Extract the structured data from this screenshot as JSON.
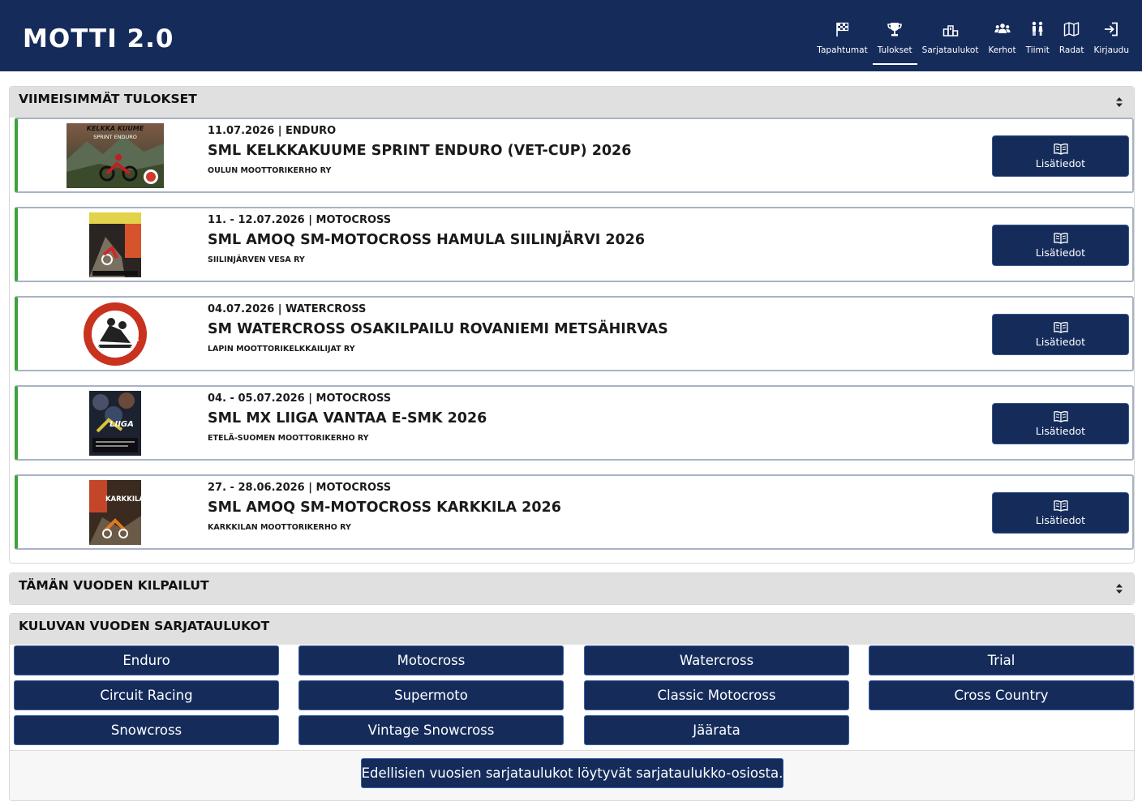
{
  "header": {
    "logo": "MOTTI 2.0",
    "nav": [
      {
        "label": "Tapahtumat",
        "icon": "checkered-flag-icon"
      },
      {
        "label": "Tulokset",
        "icon": "trophy-icon",
        "active": true
      },
      {
        "label": "Sarjataulukot",
        "icon": "podium-icon"
      },
      {
        "label": "Kerhot",
        "icon": "people-group-icon"
      },
      {
        "label": "Tiimit",
        "icon": "team-people-icon"
      },
      {
        "label": "Radat",
        "icon": "map-icon"
      },
      {
        "label": "Kirjaudu",
        "icon": "login-icon"
      }
    ]
  },
  "latest_results": {
    "title": "VIIMEISIMMÄT TULOKSET",
    "items": [
      {
        "date": "11.07.2026 | ENDURO",
        "title": "SML KELKKAKUUME SPRINT ENDURO (VET-CUP) 2026",
        "organizer": "OULUN MOOTTORIKERHO RY",
        "button": "Lisätiedot",
        "poster_text": "KELKKA KUUME",
        "poster_sub": "SPRINT ENDURO"
      },
      {
        "date": "11. - 12.07.2026 | MOTOCROSS",
        "title": "SML AMOQ SM-MOTOCROSS HAMULA SIILINJÄRVI 2026",
        "organizer": "SIILINJÄRVEN VESA RY",
        "button": "Lisätiedot"
      },
      {
        "date": "04.07.2026 | WATERCROSS",
        "title": "SM WATERCROSS OSAKILPAILU ROVANIEMI METSÄHIRVAS",
        "organizer": "LAPIN MOOTTORIKELKKAILIJAT RY",
        "button": "Lisätiedot",
        "logo_text": "LAPIN MOOTTORIKELKKAILIJAT RY"
      },
      {
        "date": "04. - 05.07.2026 | MOTOCROSS",
        "title": "SML MX LIIGA VANTAA E-SMK 2026",
        "organizer": "ETELÄ-SUOMEN MOOTTORIKERHO RY",
        "button": "Lisätiedot",
        "poster_text": "LIIGA"
      },
      {
        "date": "27. - 28.06.2026 | MOTOCROSS",
        "title": "SML AMOQ SM-MOTOCROSS KARKKILA 2026",
        "organizer": "KARKKILAN MOOTTORIKERHO RY",
        "button": "Lisätiedot",
        "poster_text": "KARKKILA"
      }
    ]
  },
  "this_year": {
    "title": "TÄMÄN VUODEN KILPAILUT"
  },
  "standings": {
    "title": "KULUVAN VUODEN SARJATAULUKOT",
    "buttons": [
      "Enduro",
      "Motocross",
      "Watercross",
      "Trial",
      "Circuit Racing",
      "Supermoto",
      "Classic Motocross",
      "Cross Country",
      "Snowcross",
      "Vintage Snowcross",
      "Jäärata"
    ],
    "archive_button": "Edellisien vuosien sarjataulukot löytyvät sarjataulukko-osiosta."
  },
  "colors": {
    "navy": "#152c5b",
    "accent_green": "#3ca33c",
    "panel_grey": "#e0e0e0"
  }
}
